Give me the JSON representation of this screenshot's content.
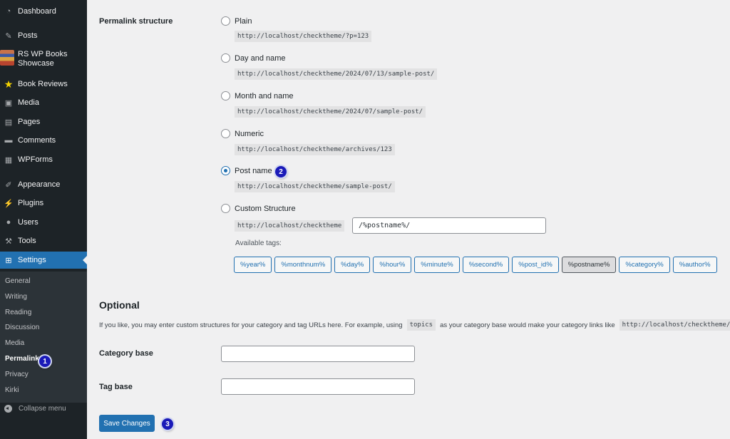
{
  "sidebar": {
    "items": [
      {
        "label": "Dashboard",
        "icon": "dashboard-icon"
      },
      {
        "label": "Posts",
        "icon": "pin-icon"
      },
      {
        "label": "RS WP Books Showcase",
        "icon": "books-icon"
      },
      {
        "label": "Book Reviews",
        "icon": "star-icon"
      },
      {
        "label": "Media",
        "icon": "media-icon"
      },
      {
        "label": "Pages",
        "icon": "pages-icon"
      },
      {
        "label": "Comments",
        "icon": "comment-icon"
      },
      {
        "label": "WPForms",
        "icon": "forms-icon"
      },
      {
        "label": "Appearance",
        "icon": "brush-icon"
      },
      {
        "label": "Plugins",
        "icon": "plug-icon"
      },
      {
        "label": "Users",
        "icon": "user-icon"
      },
      {
        "label": "Tools",
        "icon": "wrench-icon"
      },
      {
        "label": "Settings",
        "icon": "settings-icon"
      }
    ],
    "submenu": [
      "General",
      "Writing",
      "Reading",
      "Discussion",
      "Media",
      "Permalinks",
      "Privacy",
      "Kirki"
    ],
    "current_submenu": "Permalinks",
    "collapse_label": "Collapse menu"
  },
  "permalink": {
    "label": "Permalink structure",
    "options": [
      {
        "label": "Plain",
        "example": "http://localhost/checktheme/?p=123",
        "checked": false
      },
      {
        "label": "Day and name",
        "example": "http://localhost/checktheme/2024/07/13/sample-post/",
        "checked": false
      },
      {
        "label": "Month and name",
        "example": "http://localhost/checktheme/2024/07/sample-post/",
        "checked": false
      },
      {
        "label": "Numeric",
        "example": "http://localhost/checktheme/archives/123",
        "checked": false
      },
      {
        "label": "Post name",
        "example": "http://localhost/checktheme/sample-post/",
        "checked": true
      },
      {
        "label": "Custom Structure",
        "prefix": "http://localhost/checktheme",
        "value": "/%postname%/",
        "checked": false
      }
    ],
    "available_tags_label": "Available tags:",
    "tags": [
      "%year%",
      "%monthnum%",
      "%day%",
      "%hour%",
      "%minute%",
      "%second%",
      "%post_id%",
      "%postname%",
      "%category%",
      "%author%"
    ],
    "active_tag": "%postname%"
  },
  "optional": {
    "title": "Optional",
    "desc_part1": "If you like, you may enter custom structures for your category and tag URLs here. For example, using",
    "desc_code": "topics",
    "desc_part2": "as your category base would make your category links like",
    "desc_url": "http://localhost/checktheme/topics/uncategorized/",
    "category_base_label": "Category base",
    "category_base_value": "",
    "tag_base_label": "Tag base",
    "tag_base_value": ""
  },
  "save_label": "Save Changes",
  "annotations": [
    "1",
    "2",
    "3"
  ],
  "colors": {
    "accent": "#2271b1",
    "sidebar_bg": "#1d2327",
    "badge": "#1a1ab8"
  }
}
